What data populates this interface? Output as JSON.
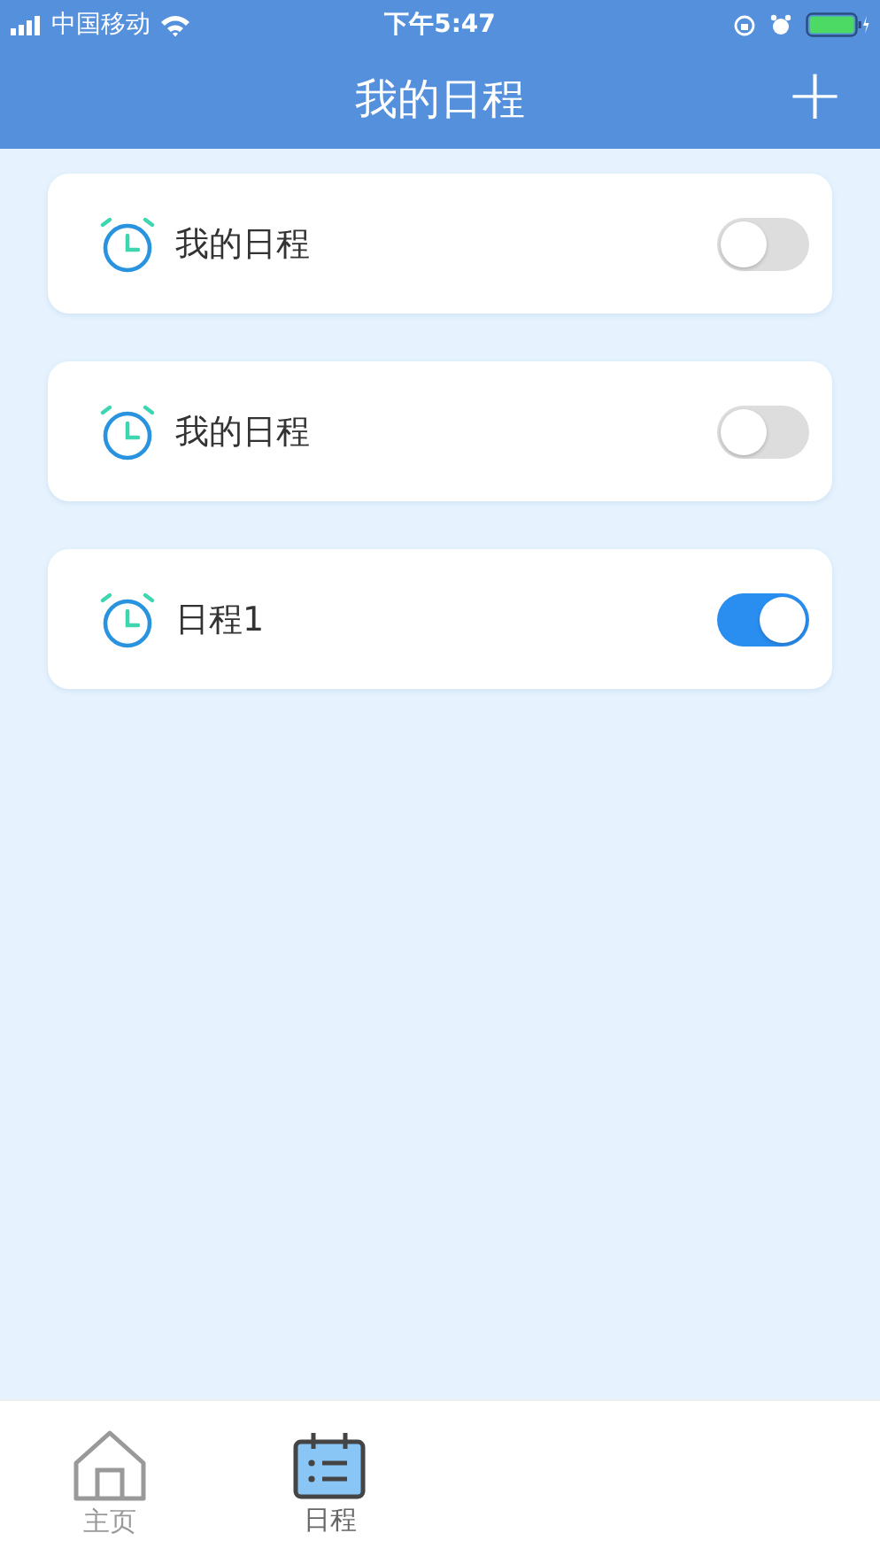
{
  "status_bar": {
    "carrier": "中国移动",
    "time": "下午5:47"
  },
  "header": {
    "title": "我的日程",
    "add_icon": "+"
  },
  "schedules": [
    {
      "name": "我的日程",
      "on": false
    },
    {
      "name": "我的日程",
      "on": false
    },
    {
      "name": "日程1",
      "on": true
    }
  ],
  "tab_bar": [
    {
      "label": "主页",
      "kind": "home",
      "selected": false
    },
    {
      "label": "日程",
      "kind": "schedule",
      "selected": true
    }
  ]
}
